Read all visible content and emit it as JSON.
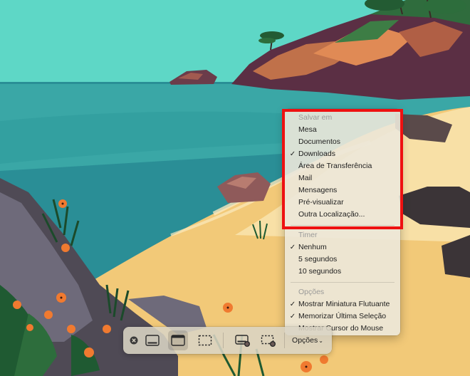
{
  "menu": {
    "save_section": {
      "header": "Salvar em",
      "items": [
        {
          "label": "Mesa",
          "checked": false
        },
        {
          "label": "Documentos",
          "checked": false
        },
        {
          "label": "Downloads",
          "checked": true
        },
        {
          "label": "Área de Transferência",
          "checked": false
        },
        {
          "label": "Mail",
          "checked": false
        },
        {
          "label": "Mensagens",
          "checked": false
        },
        {
          "label": "Pré-visualizar",
          "checked": false
        },
        {
          "label": "Outra Localização...",
          "checked": false
        }
      ]
    },
    "timer_section": {
      "header": "Timer",
      "items": [
        {
          "label": "Nenhum",
          "checked": true
        },
        {
          "label": "5 segundos",
          "checked": false
        },
        {
          "label": "10 segundos",
          "checked": false
        }
      ]
    },
    "options_section": {
      "header": "Opções",
      "items": [
        {
          "label": "Mostrar Miniatura Flutuante",
          "checked": true
        },
        {
          "label": "Memorizar Última Seleção",
          "checked": true
        },
        {
          "label": "Mostrar Cursor do Mouse",
          "checked": false
        }
      ]
    },
    "check_glyph": "✓"
  },
  "toolbar": {
    "options_label": "Opções",
    "options_chevron": "⌄",
    "buttons": [
      {
        "icon": "close-icon"
      },
      {
        "icon": "capture-entire-screen-icon"
      },
      {
        "icon": "capture-window-icon"
      },
      {
        "icon": "capture-selection-icon"
      },
      {
        "icon": "record-screen-icon"
      },
      {
        "icon": "record-selection-icon"
      }
    ]
  },
  "colors": {
    "highlight": "#ee1111",
    "sky": "#5ed7c6",
    "sea": "#2a8e96",
    "sand": "#f2c978"
  }
}
